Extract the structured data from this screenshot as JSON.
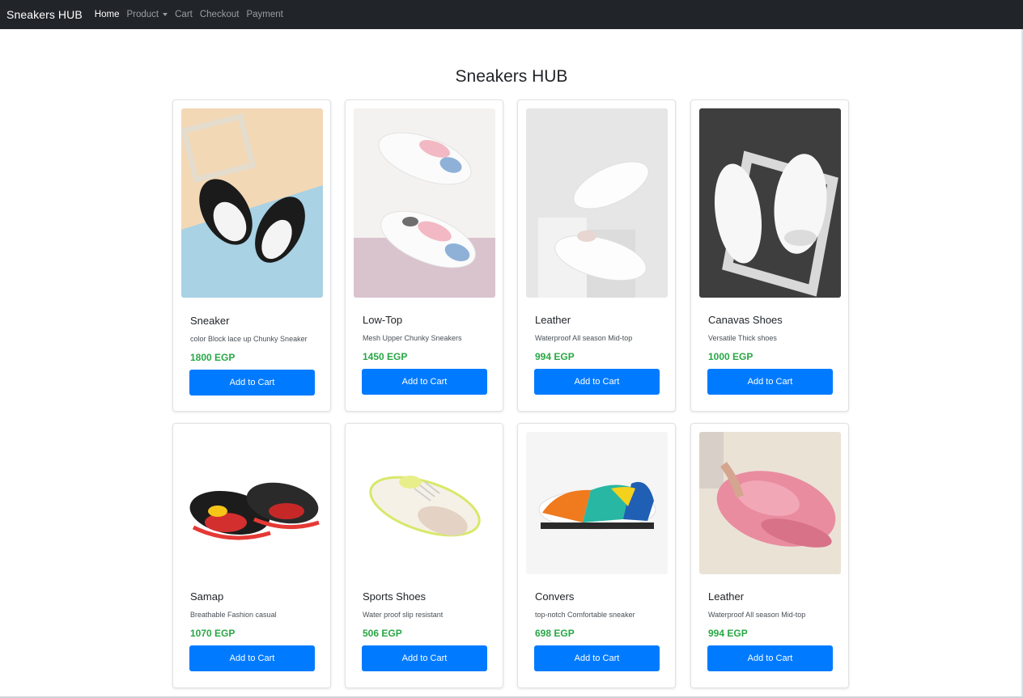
{
  "navbar": {
    "brand": "Sneakers HUB",
    "items": [
      {
        "label": "Home"
      },
      {
        "label": "Product"
      },
      {
        "label": "Cart"
      },
      {
        "label": "Checkout"
      },
      {
        "label": "Payment"
      }
    ]
  },
  "page": {
    "title": "Sneakers HUB"
  },
  "products": [
    {
      "name": "Sneaker",
      "description": "color Block lace up Chunky Sneaker",
      "price": "1800 EGP",
      "button": "Add to Cart"
    },
    {
      "name": "Low-Top",
      "description": "Mesh Upper Chunky Sneakers",
      "price": "1450 EGP",
      "button": "Add to Cart"
    },
    {
      "name": "Leather",
      "description": "Waterproof All season Mid-top",
      "price": "994 EGP",
      "button": "Add to Cart"
    },
    {
      "name": "Canavas Shoes",
      "description": "Versatile Thick shoes",
      "price": "1000 EGP",
      "button": "Add to Cart"
    },
    {
      "name": "Samap",
      "description": "Breathable Fashion casual",
      "price": "1070 EGP",
      "button": "Add to Cart"
    },
    {
      "name": "Sports Shoes",
      "description": "Water proof slip resistant",
      "price": "506 EGP",
      "button": "Add to Cart"
    },
    {
      "name": "Convers",
      "description": "top-notch Comfortable sneaker",
      "price": "698 EGP",
      "button": "Add to Cart"
    },
    {
      "name": "Leather",
      "description": "Waterproof All season Mid-top",
      "price": "994 EGP",
      "button": "Add to Cart"
    }
  ],
  "colors": {
    "navbar_bg": "#212529",
    "button": "#007bff",
    "price": "#28a745"
  }
}
